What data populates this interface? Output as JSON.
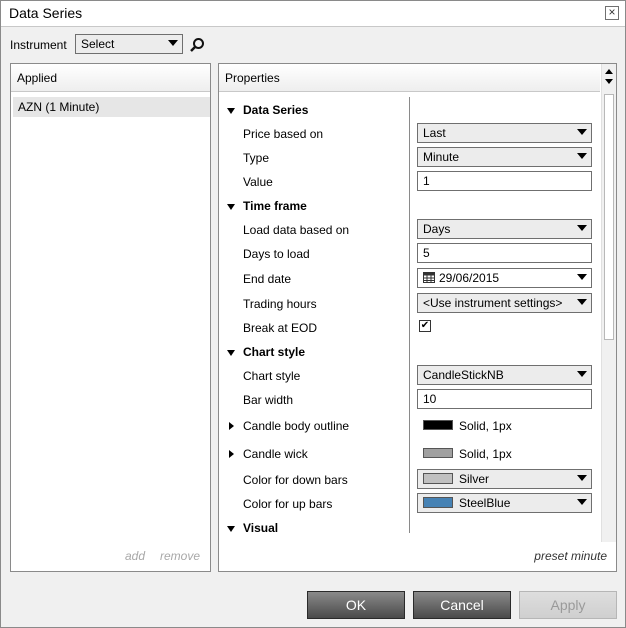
{
  "window": {
    "title": "Data Series"
  },
  "instrument": {
    "label": "Instrument",
    "select_value": "Select"
  },
  "applied": {
    "header": "Applied",
    "items": [
      "AZN (1 Minute)"
    ],
    "add_label": "add",
    "remove_label": "remove"
  },
  "properties": {
    "header": "Properties",
    "categories": [
      "Data Series",
      "Time frame",
      "Chart style",
      "Visual"
    ],
    "rows": {
      "price_based_on": {
        "label": "Price based on",
        "value": "Last"
      },
      "type": {
        "label": "Type",
        "value": "Minute"
      },
      "value": {
        "label": "Value",
        "value": "1"
      },
      "load_data_based_on": {
        "label": "Load data based on",
        "value": "Days"
      },
      "days_to_load": {
        "label": "Days to load",
        "value": "5"
      },
      "end_date": {
        "label": "End date",
        "value": "29/06/2015"
      },
      "trading_hours": {
        "label": "Trading hours",
        "value": "<Use instrument settings>"
      },
      "break_at_eod": {
        "label": "Break at EOD",
        "checked": true
      },
      "chart_style": {
        "label": "Chart style",
        "value": "CandleStickNB"
      },
      "bar_width": {
        "label": "Bar width",
        "value": "10"
      },
      "candle_body_outline": {
        "label": "Candle body outline",
        "value": "Solid, 1px",
        "color": "#000000"
      },
      "candle_wick": {
        "label": "Candle wick",
        "value": "Solid, 1px",
        "color": "#a0a0a0"
      },
      "color_down": {
        "label": "Color for down bars",
        "value": "Silver",
        "color": "#c0c0c0"
      },
      "color_up": {
        "label": "Color for up bars",
        "value": "SteelBlue",
        "color": "#4682b4"
      }
    },
    "preset_label": "preset minute"
  },
  "buttons": {
    "ok": "OK",
    "cancel": "Cancel",
    "apply": "Apply"
  },
  "icons": {
    "search": "search-icon",
    "close": "close-icon",
    "calendar": "calendar-icon"
  }
}
